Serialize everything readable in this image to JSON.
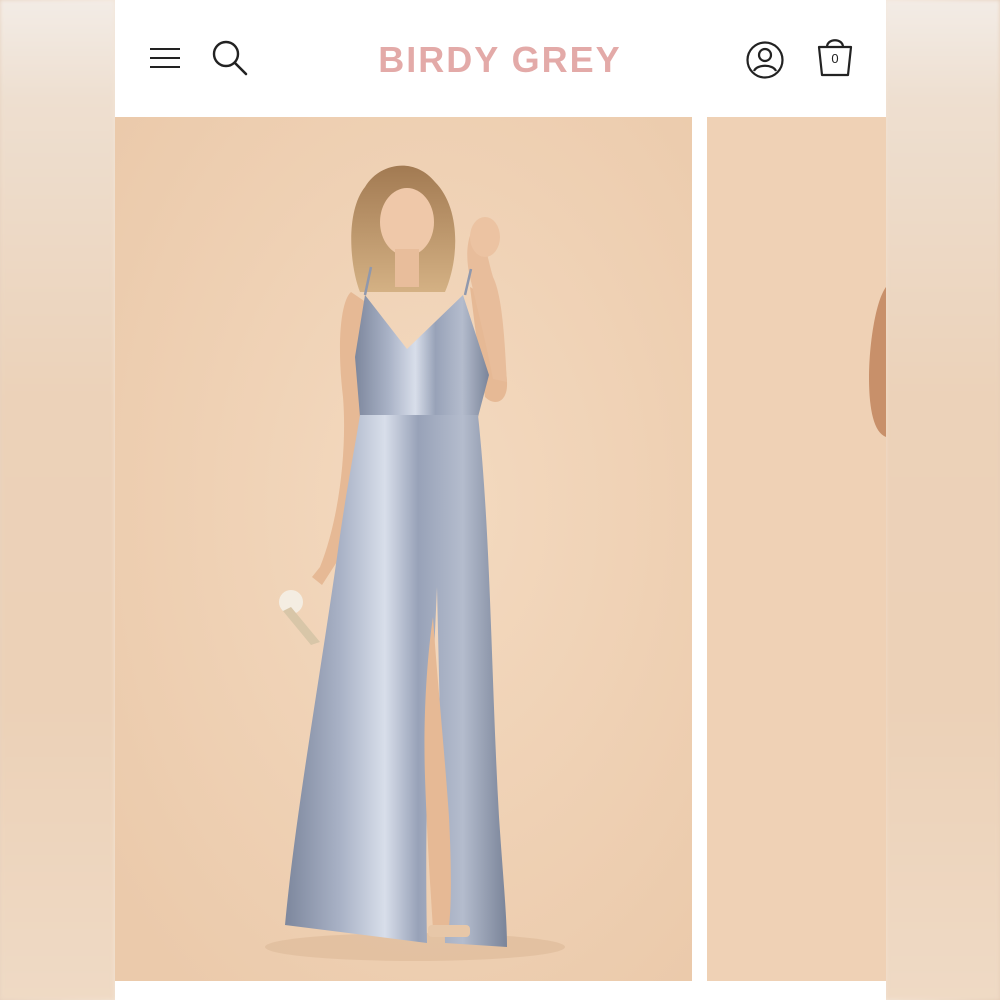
{
  "header": {
    "logo": "BIRDY GREY",
    "cart_count": "0",
    "icons": {
      "menu": "hamburger-menu-icon",
      "search": "search-icon",
      "account": "user-account-icon",
      "cart": "shopping-bag-icon"
    }
  },
  "colors": {
    "logo": "#e3aaa8",
    "photo_background": "#f0d3b7",
    "dress": "#8e98ad"
  },
  "gallery": {
    "slides": [
      {
        "description_name": "model-in-satin-slip-dress-front"
      },
      {
        "description_name": "model-partial-next-slide"
      }
    ]
  }
}
